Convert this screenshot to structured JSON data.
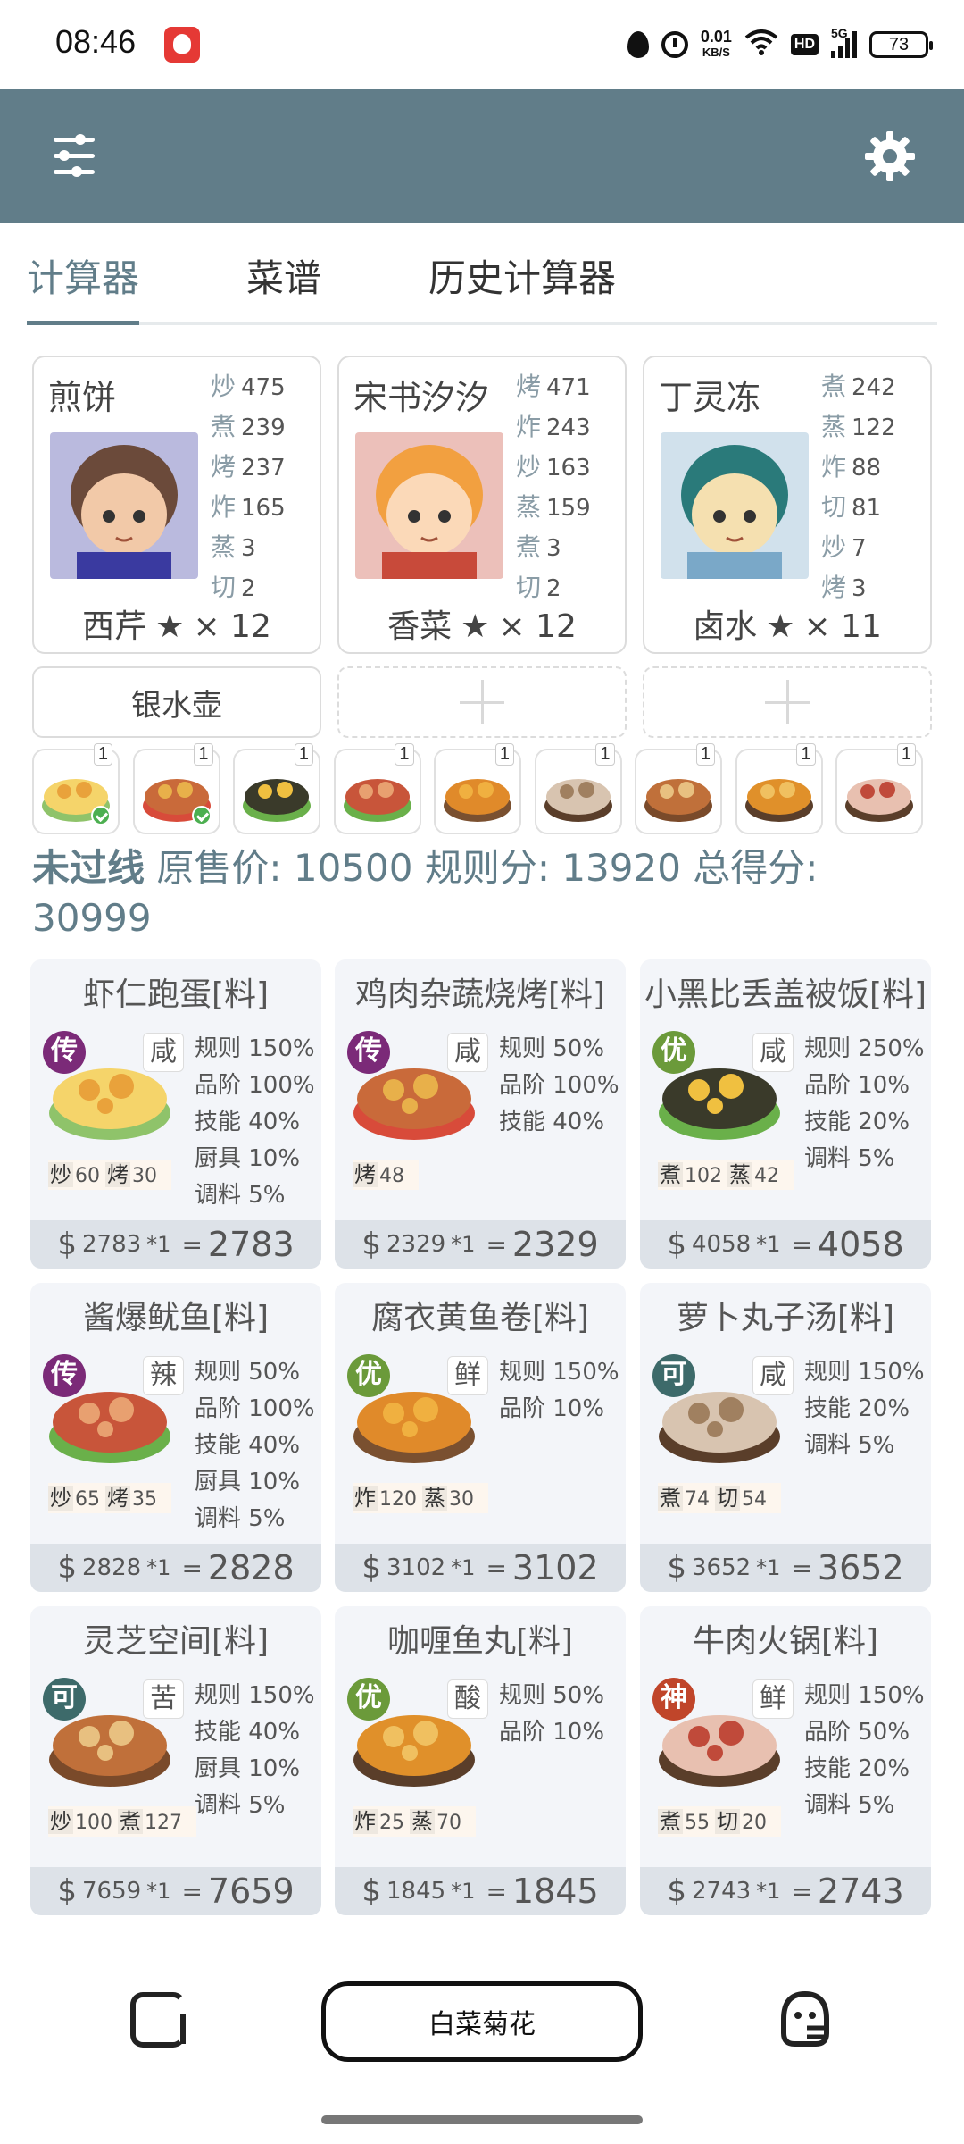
{
  "status_bar": {
    "time": "08:46",
    "net_speed_top": "0.01",
    "net_speed_unit": "KB/S",
    "hd": "HD",
    "signal": "5G",
    "battery": "73"
  },
  "tabs": [
    {
      "label": "计算器",
      "active": true
    },
    {
      "label": "菜谱",
      "active": false
    },
    {
      "label": "历史计算器",
      "active": false
    }
  ],
  "chefs": [
    {
      "name": "煎饼",
      "stats": [
        [
          "炒",
          "475"
        ],
        [
          "煮",
          "239"
        ],
        [
          "烤",
          "237"
        ],
        [
          "炸",
          "165"
        ],
        [
          "蒸",
          "3"
        ],
        [
          "切",
          "2"
        ]
      ],
      "equip": "西芹",
      "star": "★",
      "count": "× 12"
    },
    {
      "name": "宋书汐汐",
      "stats": [
        [
          "烤",
          "471"
        ],
        [
          "炸",
          "243"
        ],
        [
          "炒",
          "163"
        ],
        [
          "蒸",
          "159"
        ],
        [
          "煮",
          "3"
        ],
        [
          "切",
          "2"
        ]
      ],
      "equip": "香菜",
      "star": "★",
      "count": "× 12"
    },
    {
      "name": "丁灵冻",
      "stats": [
        [
          "煮",
          "242"
        ],
        [
          "蒸",
          "122"
        ],
        [
          "炸",
          "88"
        ],
        [
          "切",
          "81"
        ],
        [
          "炒",
          "7"
        ],
        [
          "烤",
          "3"
        ]
      ],
      "equip": "卤水",
      "star": "★",
      "count": "× 11"
    }
  ],
  "equipment": {
    "slot1": "银水壶"
  },
  "thumb_counts": [
    "1",
    "1",
    "1",
    "1",
    "1",
    "1",
    "1",
    "1",
    "1"
  ],
  "summary": {
    "status": "未过线",
    "text": "原售价: 10500 规则分: 13920 总得分: 30999"
  },
  "dishes": [
    {
      "title": "虾仁跑蛋[料]",
      "rarity": "传",
      "rarity_color": "#7b2a78",
      "taste": "咸",
      "rules": [
        "规则 150%",
        "品阶 100%",
        "技能 40%",
        "厨具 10%",
        "调料 5%"
      ],
      "skills": [
        [
          "炒",
          "60"
        ],
        [
          "烤",
          "30"
        ]
      ],
      "base": "2783",
      "mult": "*1",
      "eq": "=",
      "total": "2783",
      "colors": [
        "#f5d46a",
        "#e9a23b",
        "#8fc36a"
      ]
    },
    {
      "title": "鸡肉杂蔬烧烤[料]",
      "rarity": "传",
      "rarity_color": "#7b2a78",
      "taste": "咸",
      "rules": [
        "规则 50%",
        "品阶 100%",
        "技能 40%"
      ],
      "skills": [
        [
          "烤",
          "48"
        ]
      ],
      "base": "2329",
      "mult": "*1",
      "eq": "=",
      "total": "2329",
      "colors": [
        "#c96a3a",
        "#e8b04a",
        "#d84b3a"
      ]
    },
    {
      "title": "小黑比丢盖被饭[料]",
      "rarity": "优",
      "rarity_color": "#6b9a3a",
      "taste": "咸",
      "rules": [
        "规则 250%",
        "品阶 10%",
        "技能 20%",
        "调料 5%"
      ],
      "skills": [
        [
          "煮",
          "102"
        ],
        [
          "蒸",
          "42"
        ]
      ],
      "base": "4058",
      "mult": "*1",
      "eq": "=",
      "total": "4058",
      "colors": [
        "#3a3a2a",
        "#f0c040",
        "#6ab04a"
      ]
    },
    {
      "title": "酱爆鱿鱼[料]",
      "rarity": "传",
      "rarity_color": "#7b2a78",
      "taste": "辣",
      "rules": [
        "规则 50%",
        "品阶 100%",
        "技能 40%",
        "厨具 10%",
        "调料 5%"
      ],
      "skills": [
        [
          "炒",
          "65"
        ],
        [
          "烤",
          "35"
        ]
      ],
      "base": "2828",
      "mult": "*1",
      "eq": "=",
      "total": "2828",
      "colors": [
        "#c8553a",
        "#e8a070",
        "#6ab04a"
      ]
    },
    {
      "title": "腐衣黄鱼卷[料]",
      "rarity": "优",
      "rarity_color": "#6b9a3a",
      "taste": "鲜",
      "rules": [
        "规则 150%",
        "品阶 10%"
      ],
      "skills": [
        [
          "炸",
          "120"
        ],
        [
          "蒸",
          "30"
        ]
      ],
      "base": "3102",
      "mult": "*1",
      "eq": "=",
      "total": "3102",
      "colors": [
        "#e08a2a",
        "#f0b040",
        "#7a5030"
      ]
    },
    {
      "title": "萝卜丸子汤[料]",
      "rarity": "可",
      "rarity_color": "#3d6a6a",
      "taste": "咸",
      "rules": [
        "规则 150%",
        "技能 20%",
        "调料 5%"
      ],
      "skills": [
        [
          "煮",
          "74"
        ],
        [
          "切",
          "54"
        ]
      ],
      "base": "3652",
      "mult": "*1",
      "eq": "=",
      "total": "3652",
      "colors": [
        "#d8c4b0",
        "#a08060",
        "#5a3e2a"
      ]
    },
    {
      "title": "灵芝空间[料]",
      "rarity": "可",
      "rarity_color": "#3d6a6a",
      "taste": "苦",
      "rules": [
        "规则 150%",
        "技能 40%",
        "厨具 10%",
        "调料 5%"
      ],
      "skills": [
        [
          "炒",
          "100"
        ],
        [
          "煮",
          "127"
        ]
      ],
      "base": "7659",
      "mult": "*1",
      "eq": "=",
      "total": "7659",
      "colors": [
        "#c0703a",
        "#e8c080",
        "#7a4a2a"
      ]
    },
    {
      "title": "咖喱鱼丸[料]",
      "rarity": "优",
      "rarity_color": "#6b9a3a",
      "taste": "酸",
      "rules": [
        "规则 50%",
        "品阶 10%"
      ],
      "skills": [
        [
          "炸",
          "25"
        ],
        [
          "蒸",
          "70"
        ]
      ],
      "base": "1845",
      "mult": "*1",
      "eq": "=",
      "total": "1845",
      "colors": [
        "#e0902a",
        "#f0c060",
        "#5a3e2a"
      ]
    },
    {
      "title": "牛肉火锅[料]",
      "rarity": "神",
      "rarity_color": "#c0452a",
      "taste": "鲜",
      "rules": [
        "规则 150%",
        "品阶 50%",
        "技能 20%",
        "调料 5%"
      ],
      "skills": [
        [
          "煮",
          "55"
        ],
        [
          "切",
          "20"
        ]
      ],
      "base": "2743",
      "mult": "*1",
      "eq": "=",
      "total": "2743",
      "colors": [
        "#e8c0b0",
        "#c04a3a",
        "#5a3e2a"
      ]
    }
  ],
  "bottom": {
    "search_label": "白菜菊花"
  }
}
